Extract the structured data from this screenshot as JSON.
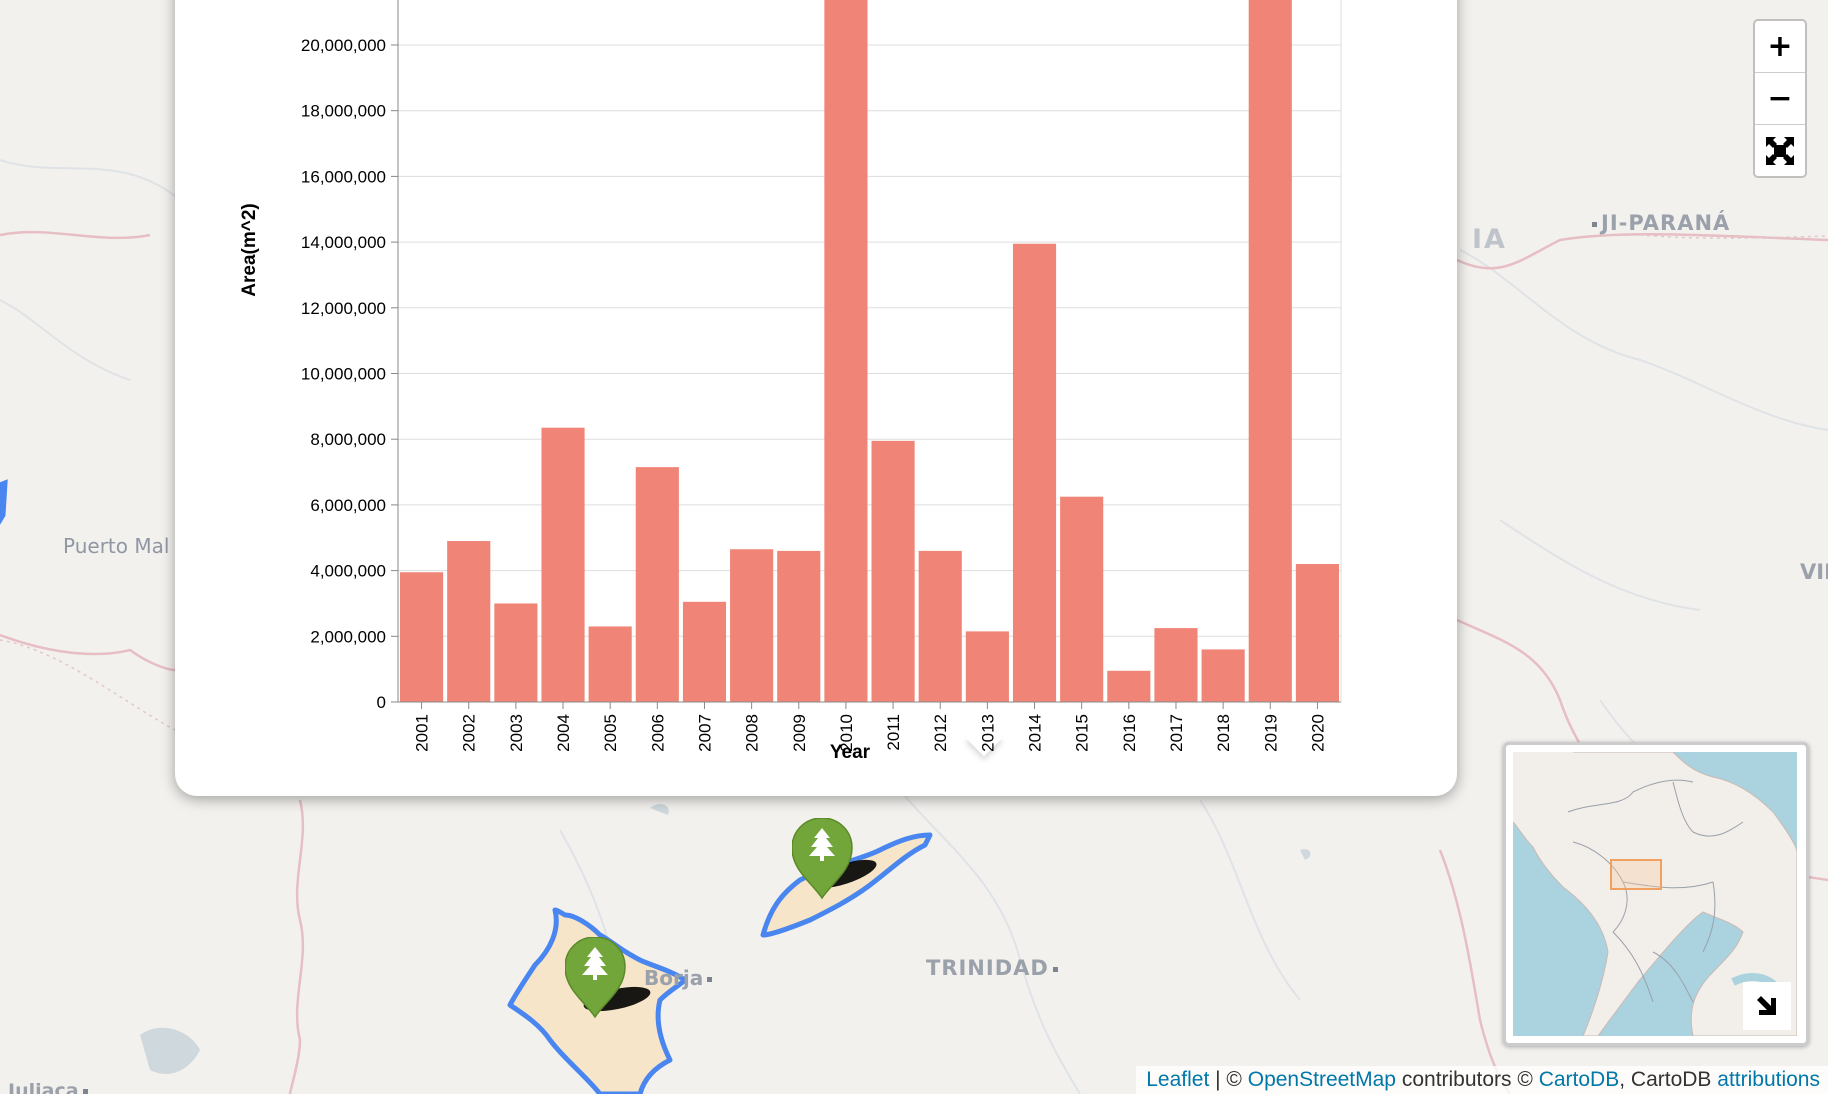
{
  "map": {
    "labels": {
      "ji_parana": "JI-PARANÁ",
      "ia_partial": "IA",
      "puerto_maldonado_partial": "Puerto Mal",
      "vil_partial": "VIL",
      "san_borja_partial": "Borja",
      "trinidad": "TRINIDAD",
      "juliaca": "Juliaca"
    },
    "zoom_in_label": "+",
    "zoom_out_label": "−",
    "fullscreen_icon": "fullscreen-icon",
    "marker_icon": "tree-icon",
    "colors": {
      "polygon_stroke": "#4a86f0",
      "polygon_fill": "#f6e5c8",
      "marker_fill": "#72a53a",
      "bar_fill": "#f08577",
      "water": "#aad3df",
      "minimap_highlight": "#f0a060"
    }
  },
  "chart_data": {
    "type": "bar",
    "categories": [
      "2001",
      "2002",
      "2003",
      "2004",
      "2005",
      "2006",
      "2007",
      "2008",
      "2009",
      "2010",
      "2011",
      "2012",
      "2013",
      "2014",
      "2015",
      "2016",
      "2017",
      "2018",
      "2019",
      "2020"
    ],
    "values": [
      3950000,
      4900000,
      3000000,
      8350000,
      2300000,
      7150000,
      3050000,
      4650000,
      4600000,
      21500000,
      7950000,
      4600000,
      2150000,
      13950000,
      6250000,
      950000,
      2250000,
      1600000,
      21500000,
      4200000
    ],
    "xlabel": "Year",
    "ylabel": "Area(m^2)",
    "yticks": [
      0,
      2000000,
      4000000,
      6000000,
      8000000,
      10000000,
      12000000,
      14000000,
      16000000,
      18000000,
      20000000
    ],
    "ylim": [
      0,
      20000000
    ],
    "grid": true
  },
  "attribution": {
    "leaflet": "Leaflet",
    "sep1": " | © ",
    "osm": "OpenStreetMap",
    "mid": " contributors © ",
    "cartodb": "CartoDB",
    "mid2": ", CartoDB ",
    "attributions": "attributions"
  }
}
